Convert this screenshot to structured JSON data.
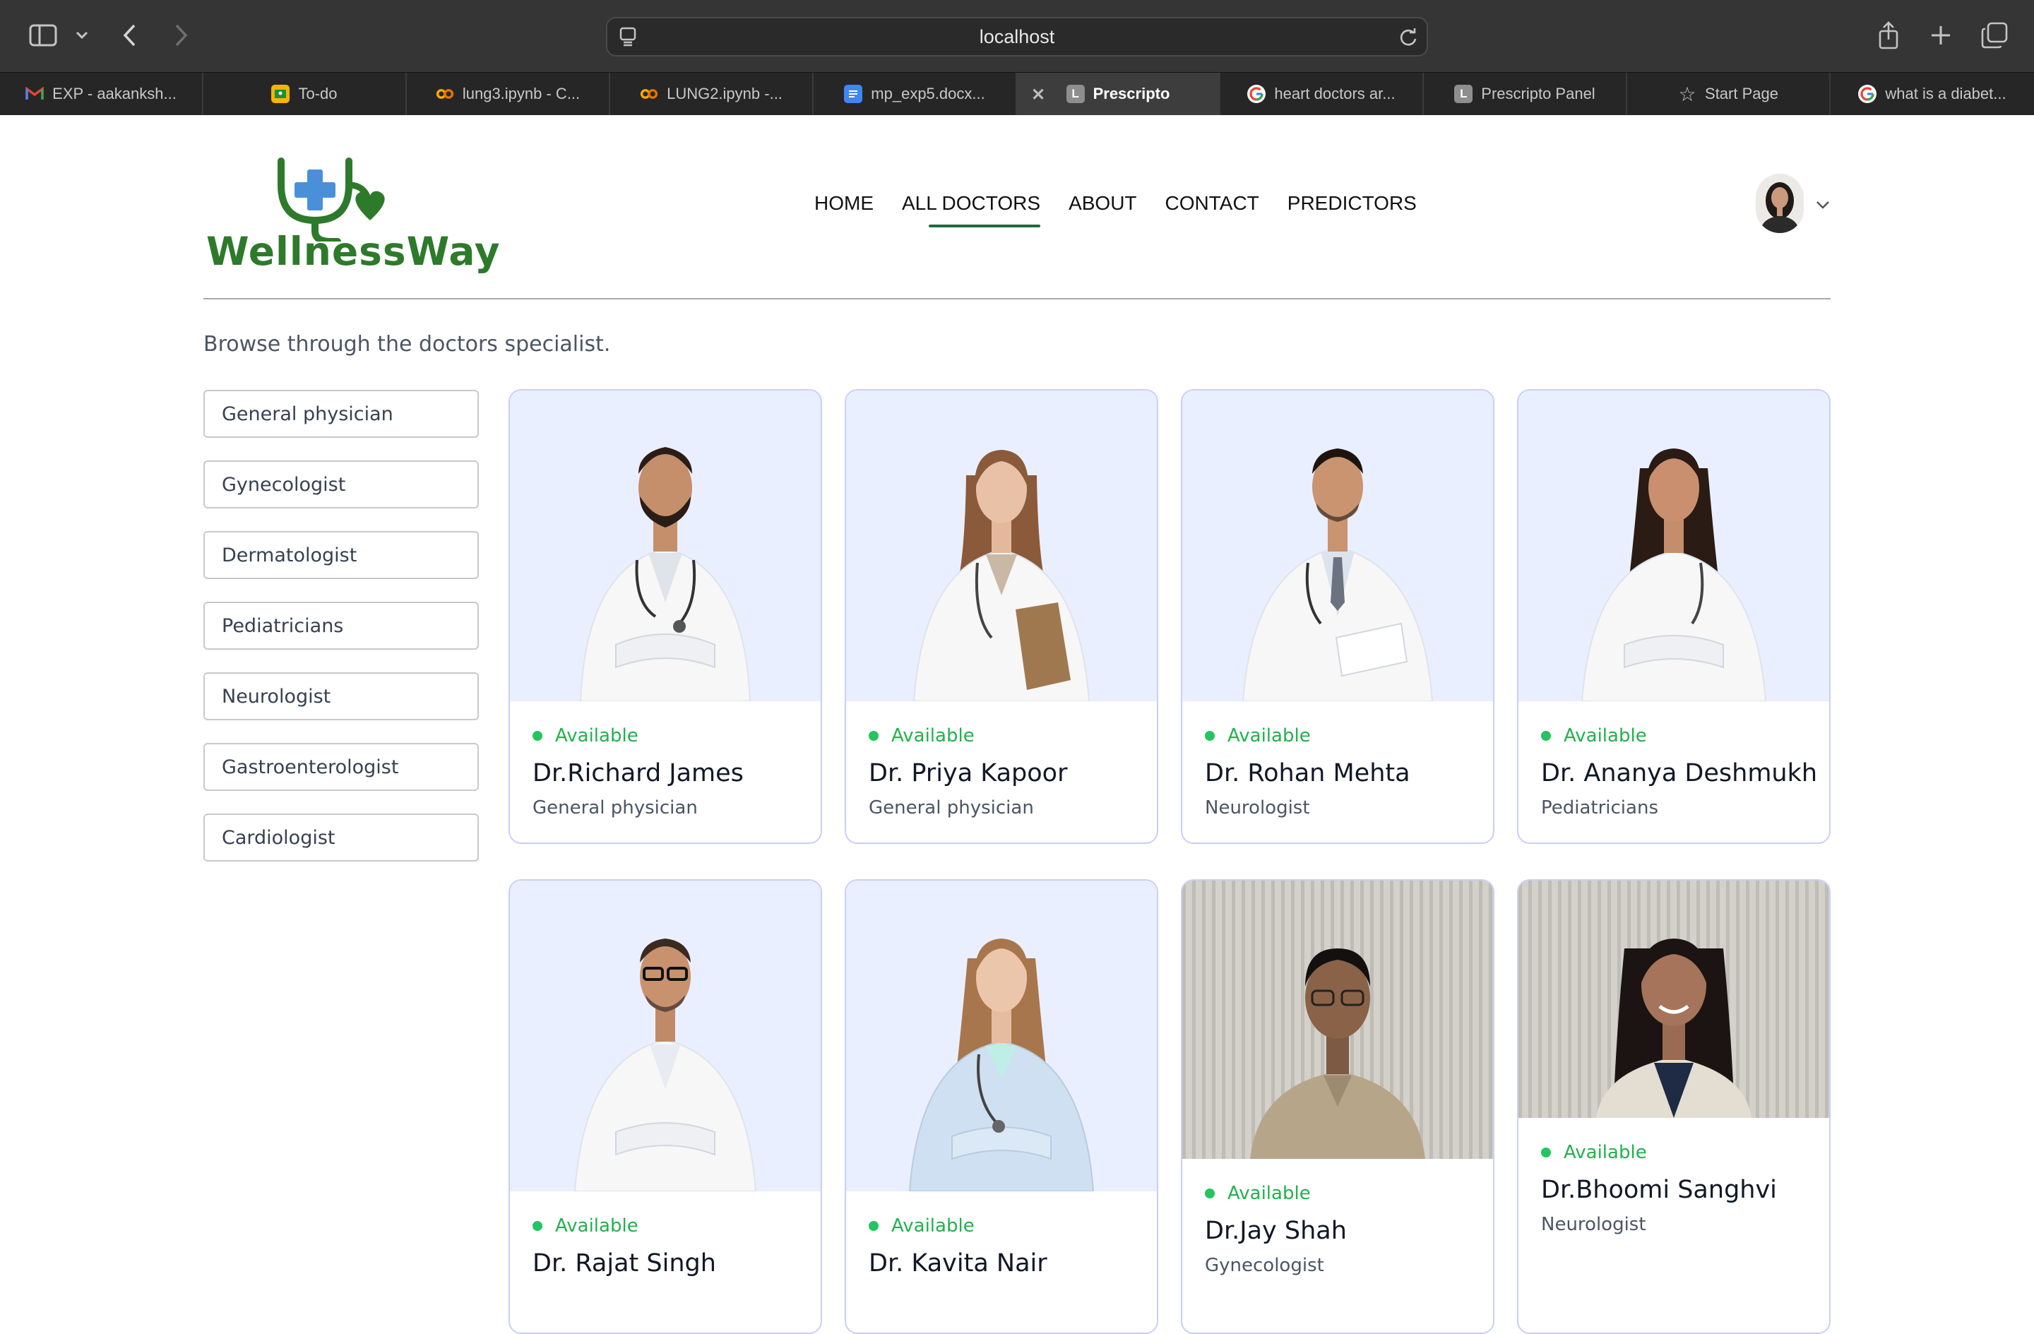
{
  "browser": {
    "address": "localhost",
    "tabs": [
      {
        "label": "EXP - aakanksh...",
        "icon": "gmail-icon",
        "color": "#ea4335"
      },
      {
        "label": "To-do",
        "icon": "classroom-icon",
        "color": "#f5b400"
      },
      {
        "label": "lung3.ipynb - C...",
        "icon": "colab-icon",
        "color": "#f9ab00"
      },
      {
        "label": "LUNG2.ipynb -...",
        "icon": "colab-icon",
        "color": "#f9ab00"
      },
      {
        "label": "mp_exp5.docx...",
        "icon": "docs-icon",
        "color": "#4285f4"
      },
      {
        "label": "Prescripto",
        "icon": "letter-l-icon",
        "color": "#8e8e8e",
        "active": true
      },
      {
        "label": "heart doctors ar...",
        "icon": "google-icon",
        "color": "#ffffff"
      },
      {
        "label": "Prescripto Panel",
        "icon": "letter-l-icon",
        "color": "#8e8e8e"
      },
      {
        "label": "Start Page",
        "icon": "star-icon",
        "color": "#c8c8c8"
      },
      {
        "label": "what is a diabet...",
        "icon": "google-icon",
        "color": "#ffffff"
      }
    ]
  },
  "site": {
    "logo_text": "WellnessWay",
    "brand_color": "#2e7a2b",
    "nav": [
      {
        "label": "HOME"
      },
      {
        "label": "ALL DOCTORS",
        "active": true
      },
      {
        "label": "ABOUT"
      },
      {
        "label": "CONTACT"
      },
      {
        "label": "PREDICTORS"
      }
    ]
  },
  "main": {
    "intro": "Browse through the doctors specialist.",
    "filters": [
      "General physician",
      "Gynecologist",
      "Dermatologist",
      "Pediatricians",
      "Neurologist",
      "Gastroenterologist",
      "Cardiologist"
    ],
    "available_color": "#22c55e",
    "doctors": [
      {
        "status": "Available",
        "name": "Dr.Richard James",
        "speciality": "General physician",
        "photo": "male doctor with beard, arms crossed"
      },
      {
        "status": "Available",
        "name": "Dr. Priya Kapoor",
        "speciality": "General physician",
        "photo": "female doctor holding clipboard"
      },
      {
        "status": "Available",
        "name": "Dr. Rohan Mehta",
        "speciality": "Neurologist",
        "photo": "male doctor with tie holding tablet"
      },
      {
        "status": "Available",
        "name": "Dr. Ananya Deshmukh",
        "speciality": "Pediatricians",
        "photo": "female doctor arms crossed"
      },
      {
        "status": "Available",
        "name": "Dr. Rajat Singh",
        "speciality": "",
        "photo": "male doctor with glasses, arms crossed"
      },
      {
        "status": "Available",
        "name": "Dr. Kavita Nair",
        "speciality": "",
        "photo": "female doctor with stethoscope, arms crossed"
      },
      {
        "status": "Available",
        "name": "Dr.Jay Shah",
        "speciality": "Gynecologist",
        "photo": "young man with glasses, beige shirt"
      },
      {
        "status": "Available",
        "name": "Dr.Bhoomi Sanghvi",
        "speciality": "Neurologist",
        "photo": "young woman smiling"
      }
    ]
  }
}
